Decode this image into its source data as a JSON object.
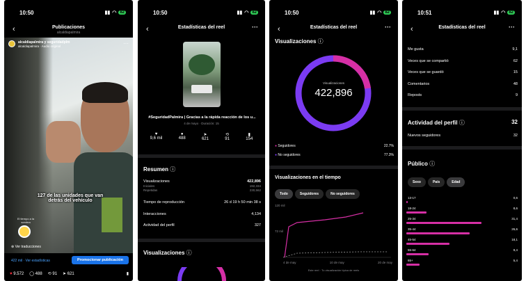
{
  "phone1": {
    "time": "10:50",
    "battery": "82",
    "title": "Publicaciones",
    "subtitle": "alcaldiapalmira",
    "author": "alcaldiapalmira y seguridadplm",
    "audio": "alcaldiapalmira · Audio original",
    "caption": "127 de las unidades que van detrás del vehículo",
    "avatar_note": "El tiempo a la\nsombra",
    "translate": "Ver traducciones",
    "insights": "422 mil · Ver estadísticas",
    "promote": "Promocionar publicación",
    "likes": "9.572",
    "comments": "488",
    "reposts": "91",
    "shares": "621"
  },
  "phone2": {
    "time": "10:50",
    "battery": "82",
    "title": "Estadísticas del reel",
    "headline": "#SeguridadPalmira | Gracias a la rápida reacción de los u...",
    "date": "4 de mayo · Duración: 15",
    "stats": [
      {
        "icon": "heart-icon",
        "value": "9,6 mil"
      },
      {
        "icon": "comment-icon",
        "value": "488"
      },
      {
        "icon": "share-icon",
        "value": "621"
      },
      {
        "icon": "repost-icon",
        "value": "91"
      },
      {
        "icon": "bookmark-icon",
        "value": "154"
      }
    ],
    "summary_title": "Resumen",
    "views_label": "Visualizaciones",
    "views_value": "422,896",
    "initial_label": "Iniciales",
    "initial_value": "192,334",
    "repeat_label": "Repetidas",
    "repeat_value": "230,562",
    "watch_label": "Tiempo de reproducción",
    "watch_value": "26 d 19 h 50 min 38 s",
    "interactions_label": "Interacciones",
    "interactions_value": "4,134",
    "profile_label": "Actividad del perfil",
    "profile_value": "327",
    "views_section": "Visualizaciones"
  },
  "phone3": {
    "time": "10:50",
    "battery": "82",
    "title": "Estadísticas del reel",
    "section": "Visualizaciones",
    "donut_label": "Visualizaciones",
    "donut_value": "422,896",
    "followers_label": "Seguidores",
    "followers_value": "22.7%",
    "nonfollowers_label": "No seguidores",
    "nonfollowers_value": "77.3%",
    "followers_fraction": 0.227,
    "time_title": "Visualizaciones en el tiempo",
    "tabs": [
      "Todo",
      "Seguidores",
      "No seguidores"
    ],
    "y_top": "120 mil",
    "y_mid": "72 mil",
    "x_labels": [
      "4 de may",
      "10 de may",
      "20 de may"
    ],
    "legend": "Este reel · Tu visualización típica de reels"
  },
  "phone4": {
    "time": "10:51",
    "battery": "82",
    "title": "Estadísticas del reel",
    "rows": [
      {
        "label": "Me gusta",
        "value": "9,1"
      },
      {
        "label": "Veces que se compartió",
        "value": "62"
      },
      {
        "label": "Veces que se guardó",
        "value": "15"
      },
      {
        "label": "Comentarios",
        "value": "48"
      },
      {
        "label": "Reposts",
        "value": "9"
      }
    ],
    "profile_title": "Actividad del perfil",
    "profile_value": "32",
    "new_followers_label": "Nuevos seguidores",
    "new_followers_value": "32",
    "audience_title": "Público",
    "tabs": [
      "Sexo",
      "País",
      "Edad"
    ],
    "ages": [
      {
        "label": "13-17",
        "value": "0,6",
        "pct": 0.6
      },
      {
        "label": "18-24",
        "value": "8,6",
        "pct": 8.6
      },
      {
        "label": "25-34",
        "value": "31,4",
        "pct": 31.4
      },
      {
        "label": "35-44",
        "value": "26,6",
        "pct": 26.6
      },
      {
        "label": "45-54",
        "value": "18,1",
        "pct": 18.1
      },
      {
        "label": "55-64",
        "value": "9,4",
        "pct": 9.4
      },
      {
        "label": "65+",
        "value": "5,4",
        "pct": 5.4
      }
    ]
  }
}
